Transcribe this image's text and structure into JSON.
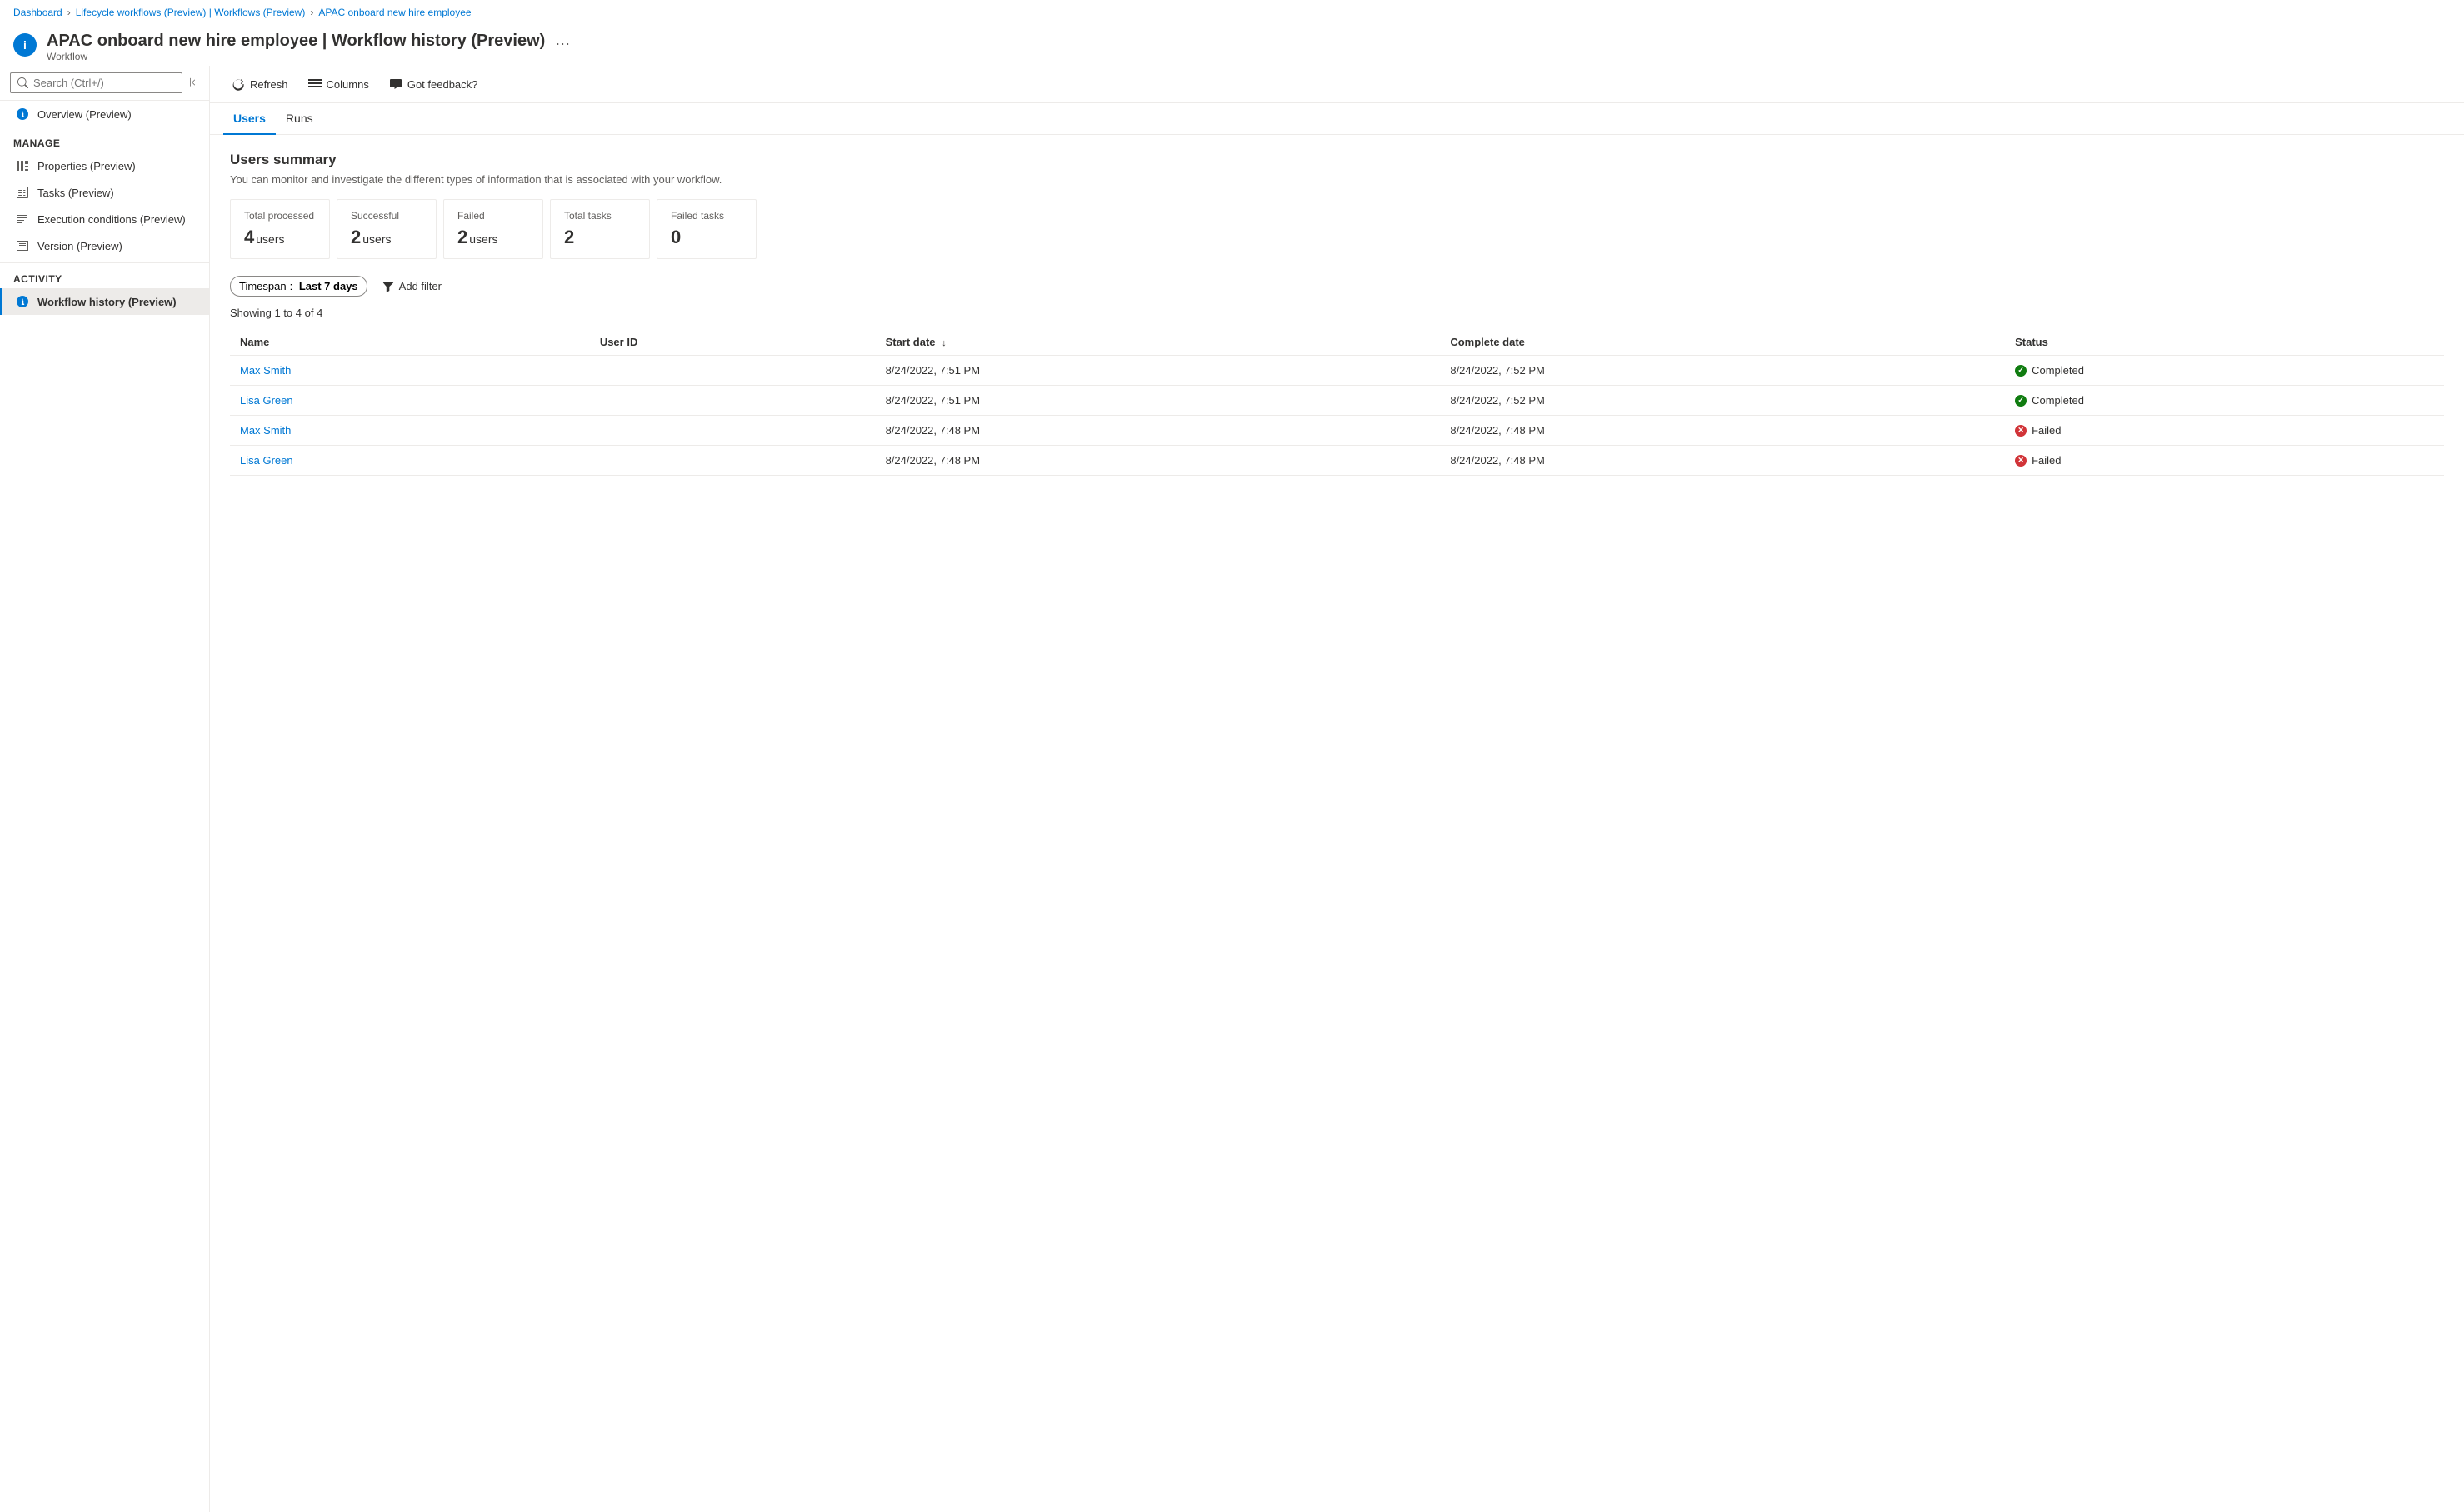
{
  "breadcrumb": {
    "items": [
      {
        "label": "Dashboard",
        "href": true
      },
      {
        "label": "Lifecycle workflows (Preview) | Workflows (Preview)",
        "href": true
      },
      {
        "label": "APAC onboard new hire employee",
        "href": true
      }
    ]
  },
  "header": {
    "title": "APAC onboard new hire employee | Workflow history (Preview)",
    "subtitle": "Workflow",
    "icon": "i",
    "ellipsis": "···"
  },
  "sidebar": {
    "search_placeholder": "Search (Ctrl+/)",
    "overview_label": "Overview (Preview)",
    "manage_section": "Manage",
    "manage_items": [
      {
        "label": "Properties (Preview)",
        "icon": "properties"
      },
      {
        "label": "Tasks (Preview)",
        "icon": "tasks"
      },
      {
        "label": "Execution conditions (Preview)",
        "icon": "execution"
      },
      {
        "label": "Version (Preview)",
        "icon": "version"
      }
    ],
    "activity_section": "Activity",
    "activity_items": [
      {
        "label": "Workflow history (Preview)",
        "icon": "history",
        "active": true
      }
    ]
  },
  "toolbar": {
    "refresh_label": "Refresh",
    "columns_label": "Columns",
    "feedback_label": "Got feedback?"
  },
  "tabs": [
    {
      "label": "Users",
      "active": true
    },
    {
      "label": "Runs",
      "active": false
    }
  ],
  "users_summary": {
    "title": "Users summary",
    "description": "You can monitor and investigate the different types of information that is associated with your workflow.",
    "cards": [
      {
        "title": "Total processed",
        "value": "4",
        "unit": "users"
      },
      {
        "title": "Successful",
        "value": "2",
        "unit": "users"
      },
      {
        "title": "Failed",
        "value": "2",
        "unit": "users"
      },
      {
        "title": "Total tasks",
        "value": "2",
        "unit": ""
      },
      {
        "title": "Failed tasks",
        "value": "0",
        "unit": ""
      }
    ]
  },
  "filters": {
    "timespan_label": "Timespan",
    "timespan_value": "Last 7 days",
    "add_filter_label": "Add filter"
  },
  "table": {
    "showing_text": "Showing 1 to 4 of 4",
    "columns": [
      {
        "label": "Name"
      },
      {
        "label": "User ID"
      },
      {
        "label": "Start date",
        "sort": "↓"
      },
      {
        "label": "Complete date"
      },
      {
        "label": "Status"
      }
    ],
    "rows": [
      {
        "name": "Max Smith",
        "user_id": "",
        "start_date": "8/24/2022, 7:51 PM",
        "complete_date": "8/24/2022, 7:52 PM",
        "status": "Completed",
        "status_type": "completed"
      },
      {
        "name": "Lisa Green",
        "user_id": "",
        "start_date": "8/24/2022, 7:51 PM",
        "complete_date": "8/24/2022, 7:52 PM",
        "status": "Completed",
        "status_type": "completed"
      },
      {
        "name": "Max Smith",
        "user_id": "",
        "start_date": "8/24/2022, 7:48 PM",
        "complete_date": "8/24/2022, 7:48 PM",
        "status": "Failed",
        "status_type": "failed"
      },
      {
        "name": "Lisa Green",
        "user_id": "",
        "start_date": "8/24/2022, 7:48 PM",
        "complete_date": "8/24/2022, 7:48 PM",
        "status": "Failed",
        "status_type": "failed"
      }
    ]
  }
}
